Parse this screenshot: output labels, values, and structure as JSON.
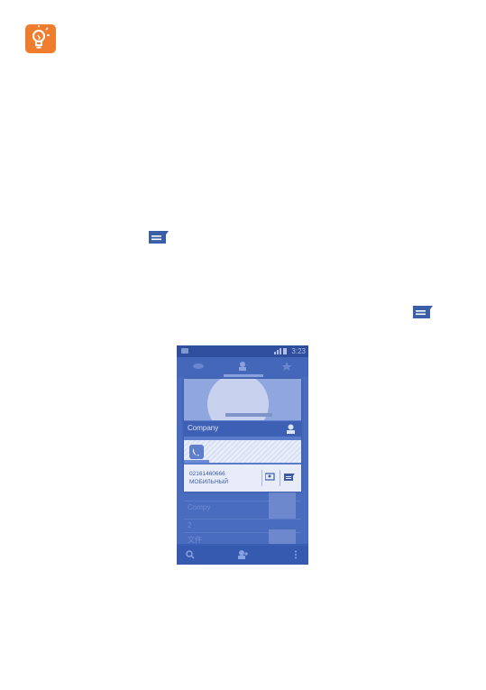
{
  "icons": {
    "tip": "lightbulb-icon",
    "message_inline_1": "message-icon",
    "message_inline_2": "message-icon"
  },
  "colors": {
    "tip_bg": "#f07c2e",
    "message_icon": "#3a5fa8",
    "screen_bg": "#3b5fb4"
  },
  "screenshot": {
    "status_time": "3:23",
    "contact_name": "Company",
    "phone_number": "02161460666",
    "number_type": "МОБИЛЬНЫЙ",
    "bg_list": [
      "Compy",
      "2",
      "文件"
    ]
  }
}
